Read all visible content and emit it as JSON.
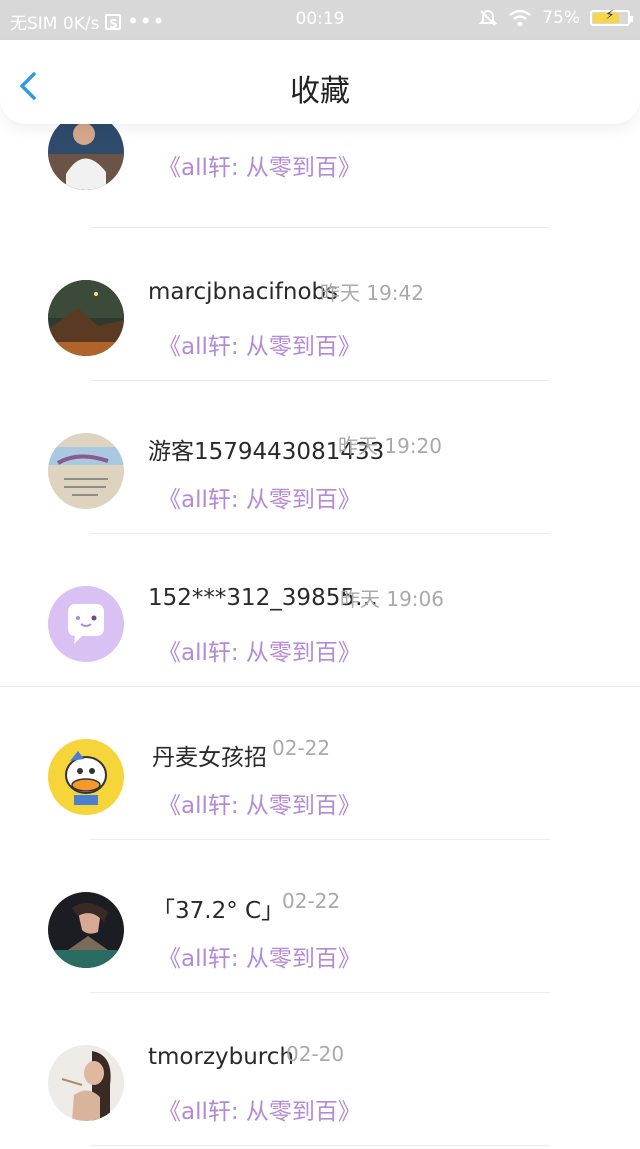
{
  "status_bar": {
    "carrier": "无SIM 0K/s",
    "s_badge": "S",
    "dots": "•••",
    "time": "00:19",
    "battery": "75%"
  },
  "header": {
    "title": "收藏"
  },
  "items": [
    {
      "name": "",
      "time": "",
      "comment": "《all轩:  从零到百》"
    },
    {
      "name": "marcjbnacifnobs",
      "time": "昨天 19:42",
      "comment": "《all轩:  从零到百》"
    },
    {
      "name": "游客1579443081433",
      "time": "昨天 19:20",
      "comment": "《all轩:  从零到百》"
    },
    {
      "name": "152***312_39855…",
      "time": "昨天 19:06",
      "comment": "《all轩:  从零到百》"
    },
    {
      "name": "丹麦女孩招",
      "time": "02-22",
      "comment": "《all轩:  从零到百》"
    },
    {
      "name": "「37.2° C」",
      "time": "02-22",
      "comment": "《all轩:  从零到百》"
    },
    {
      "name": "tmorzyburch",
      "time": "02-20",
      "comment": "《all轩:  从零到百》"
    }
  ]
}
